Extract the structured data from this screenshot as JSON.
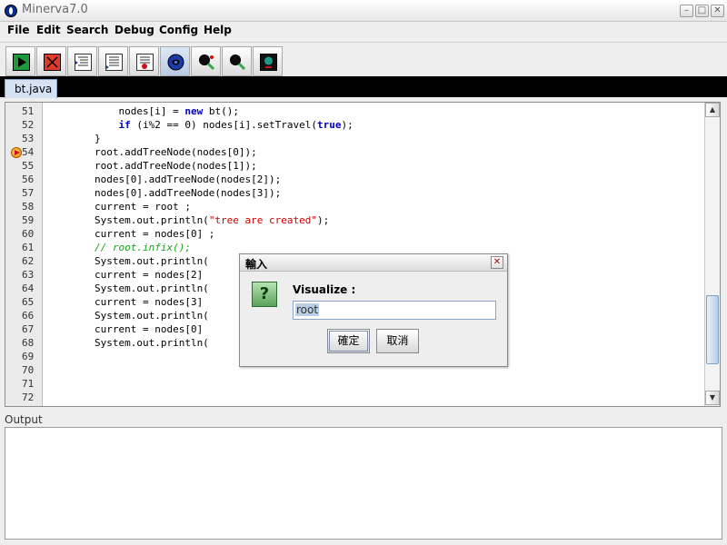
{
  "window": {
    "title": "Minerva7.0",
    "controls": [
      "minimize",
      "maximize",
      "close"
    ]
  },
  "menu": [
    "File",
    "Edit",
    "Search",
    "Debug",
    "Config",
    "Help"
  ],
  "toolbar": {
    "buttons": [
      "run",
      "stop",
      "step",
      "step-over",
      "breakpoint",
      "visualize",
      "zoom-in",
      "zoom-out",
      "display"
    ]
  },
  "tabs": [
    {
      "label": "bt.java",
      "active": true
    }
  ],
  "editor": {
    "breakpoint_line": "54",
    "lines": [
      {
        "no": "51",
        "code": "            nodes[i] = new bt();"
      },
      {
        "no": "52",
        "code": "            if (i%2 == 0) nodes[i].setTravel(true);"
      },
      {
        "no": "53",
        "code": "        }"
      },
      {
        "no": "54",
        "code": "        root.addTreeNode(nodes[0]);"
      },
      {
        "no": "55",
        "code": "        root.addTreeNode(nodes[1]);"
      },
      {
        "no": "56",
        "code": "        nodes[0].addTreeNode(nodes[2]);"
      },
      {
        "no": "57",
        "code": "        nodes[0].addTreeNode(nodes[3]);"
      },
      {
        "no": "58",
        "code": "        current = root ;"
      },
      {
        "no": "59",
        "code": "        System.out.println(\"tree are created\");"
      },
      {
        "no": "60",
        "code": "        current = nodes[0] ;"
      },
      {
        "no": "61",
        "code": "        // root.infix();"
      },
      {
        "no": "62",
        "code": "        System.out.println("
      },
      {
        "no": "63",
        "code": "        current = nodes[2]"
      },
      {
        "no": "64",
        "code": "        System.out.println("
      },
      {
        "no": "65",
        "code": "        current = nodes[3]"
      },
      {
        "no": "66",
        "code": "        System.out.println("
      },
      {
        "no": "67",
        "code": "        current = nodes[0]"
      },
      {
        "no": "68",
        "code": "        System.out.println("
      },
      {
        "no": "69",
        "code": ""
      },
      {
        "no": "70",
        "code": ""
      },
      {
        "no": "71",
        "code": ""
      },
      {
        "no": "72",
        "code": ""
      }
    ]
  },
  "output": {
    "label": "Output",
    "content": ""
  },
  "dialog": {
    "title": "輸入",
    "prompt": "Visualize :",
    "input_value": "root",
    "ok_label": "確定",
    "cancel_label": "取消",
    "icon": "question-icon"
  },
  "colors": {
    "keyword": "#0000cc",
    "string": "#cc0000",
    "comment": "#1aa01a",
    "tab_bg": "#d6e2f3"
  }
}
